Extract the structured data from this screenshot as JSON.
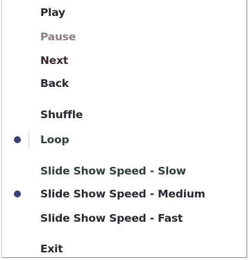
{
  "menu": {
    "items": [
      {
        "label": "Play"
      },
      {
        "label": "Pause",
        "state": "disabled"
      },
      {
        "label": "Next"
      },
      {
        "label": "Back"
      },
      {
        "label": "Shuffle"
      },
      {
        "label": "Loop",
        "checked": true
      },
      {
        "label": "Slide Show Speed - Slow"
      },
      {
        "label": "Slide Show Speed - Medium",
        "checked": true
      },
      {
        "label": "Slide Show Speed - Fast"
      },
      {
        "label": "Exit"
      }
    ]
  },
  "colors": {
    "text": "#262a30",
    "disabled_text": "#8c7f89",
    "bullet": "#3d3f7a",
    "border": "#8a8a8a"
  }
}
